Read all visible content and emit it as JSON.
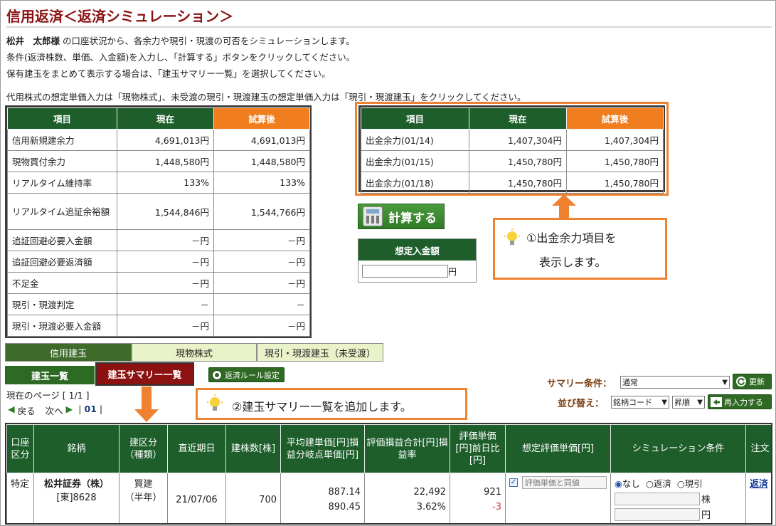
{
  "title": "信用返済＜返済シミュレーション＞",
  "intro": {
    "name": "松井　太郎様",
    "line1_rest": " の口座状況から、各余力や現引・現渡の可否をシミュレーションします。",
    "line2": "条件(返済株数、単価、入金額)を入力し、「計算する」ボタンをクリックしてください。",
    "line3": "保有建玉をまとめて表示する場合は、「建玉サマリー一覧」を選択してください。",
    "line4": "代用株式の想定単価入力は「現物株式」、未受渡の現引・現渡建玉の想定単価入力は「現引・現渡建玉」をクリックしてください。"
  },
  "left_table": {
    "headers": [
      "項目",
      "現在",
      "試算後"
    ],
    "rows": [
      [
        "信用新規建余力",
        "4,691,013円",
        "4,691,013円"
      ],
      [
        "現物買付余力",
        "1,448,580円",
        "1,448,580円"
      ],
      [
        "リアルタイム維持率",
        "133%",
        "133%"
      ],
      [
        "リアルタイム追証余裕額",
        "1,544,846円",
        "1,544,766円"
      ],
      [
        "追証回避必要入金額",
        "－円",
        "－円"
      ],
      [
        "追証回避必要返済額",
        "－円",
        "－円"
      ],
      [
        "不足金",
        "－円",
        "－円"
      ],
      [
        "現引・現渡判定",
        "－",
        "－"
      ],
      [
        "現引・現渡必要入金額",
        "－円",
        "－円"
      ]
    ]
  },
  "right_table": {
    "headers": [
      "項目",
      "現在",
      "試算後"
    ],
    "rows": [
      [
        "出金余力(01/14)",
        "1,407,304円",
        "1,407,304円"
      ],
      [
        "出金余力(01/15)",
        "1,450,780円",
        "1,450,780円"
      ],
      [
        "出金余力(01/18)",
        "1,450,780円",
        "1,450,780円"
      ]
    ]
  },
  "calc_button": "計算する",
  "deposit": {
    "header": "想定入金額",
    "value": "",
    "unit": "円"
  },
  "callout1": {
    "line1": "①出金余力項目を",
    "line2": "表示します。"
  },
  "callout2": "②建玉サマリー一覧を追加します。",
  "tabs": [
    "信用建玉",
    "現物株式",
    "現引・現渡建玉（未受渡）"
  ],
  "subtabs": {
    "list": "建玉一覧",
    "summary": "建玉サマリー一覧",
    "rule": "返済ルール設定"
  },
  "summary_condition": {
    "label": "サマリー条件：",
    "value": "通常",
    "update": "更新"
  },
  "sort": {
    "label": "並び替え：",
    "key": "銘柄コード",
    "order": "昇順",
    "reenter": "再入力する"
  },
  "paging": {
    "current": "現在のページ [ 1/1 ]",
    "prev": "戻る",
    "next": "次へ",
    "page": "01"
  },
  "positions": {
    "headers": {
      "account": "口座区分",
      "stock": "銘柄",
      "type": "建区分（種類）",
      "date": "直近期日",
      "qty": "建株数[株]",
      "avg": "平均建単価[円]損益分岐点単価[円]",
      "pl": "評価損益合計[円]損益率",
      "eval": "評価単価[円]前日比[円]",
      "assumed": "想定評価単価[円]",
      "sim": "シミュレーション条件",
      "order": "注文"
    },
    "row": {
      "account": "特定",
      "stock_name": "松井証券（株）",
      "stock_code": "[東]8628",
      "type1": "買建",
      "type2": "（半年）",
      "date": "21/07/06",
      "qty": "700",
      "avg": "887.14",
      "breakeven": "890.45",
      "pl": "22,492",
      "pl_rate": "3.62%",
      "eval": "921",
      "change": "-3",
      "assumed_placeholder": "評価単価と同値",
      "sim_options": [
        "なし",
        "返済",
        "現引"
      ],
      "unit_shares": "株",
      "unit_yen": "円",
      "order_link": "返済"
    }
  }
}
